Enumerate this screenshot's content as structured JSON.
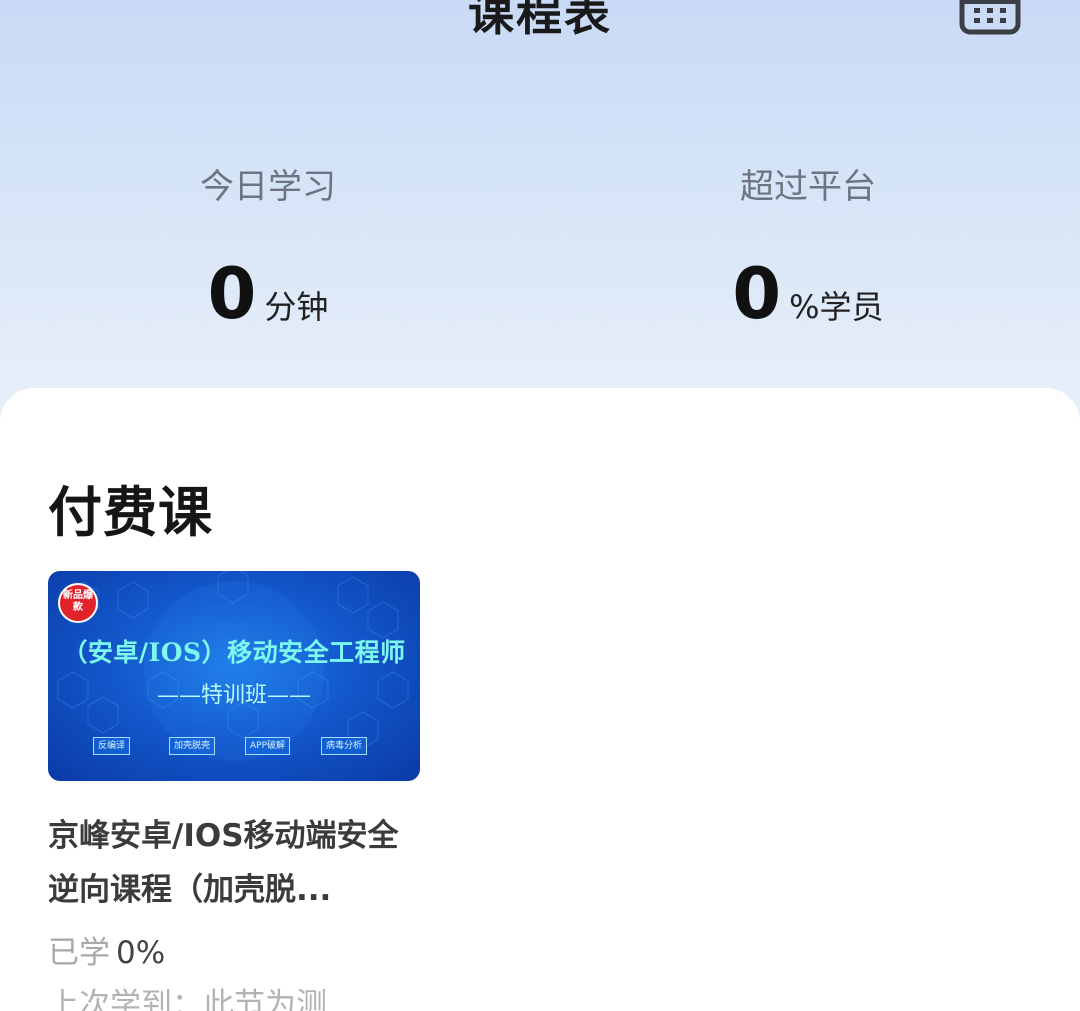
{
  "header": {
    "title": "课程表",
    "calendar_icon": "calendar-icon"
  },
  "stats": {
    "today": {
      "label": "今日学习",
      "value": "0",
      "unit": "分钟"
    },
    "exceed": {
      "label": "超过平台",
      "value": "0",
      "unit": "%学员"
    }
  },
  "section": {
    "title": "付费课"
  },
  "course": {
    "thumbnail": {
      "badge": "新品爆款",
      "title": "（安卓/IOS）移动安全工程师",
      "subtitle": "——特训班——",
      "tags": [
        "反编译",
        "加壳脱壳",
        "APP破解",
        "病毒分析"
      ]
    },
    "title": "京峰安卓/IOS移动端安全逆向课程（加壳脱...",
    "progress_label": "已学",
    "progress_value": "0%",
    "progress_fraction": 0,
    "last_label": "上次学到：此节为测"
  },
  "colors": {
    "header_gradient_top": "#c9daf6",
    "panel_background": "#ffffff",
    "thumbnail_blue": "#1358cc",
    "thumbnail_text": "#7ef7ef",
    "badge_red": "#e3232c"
  }
}
